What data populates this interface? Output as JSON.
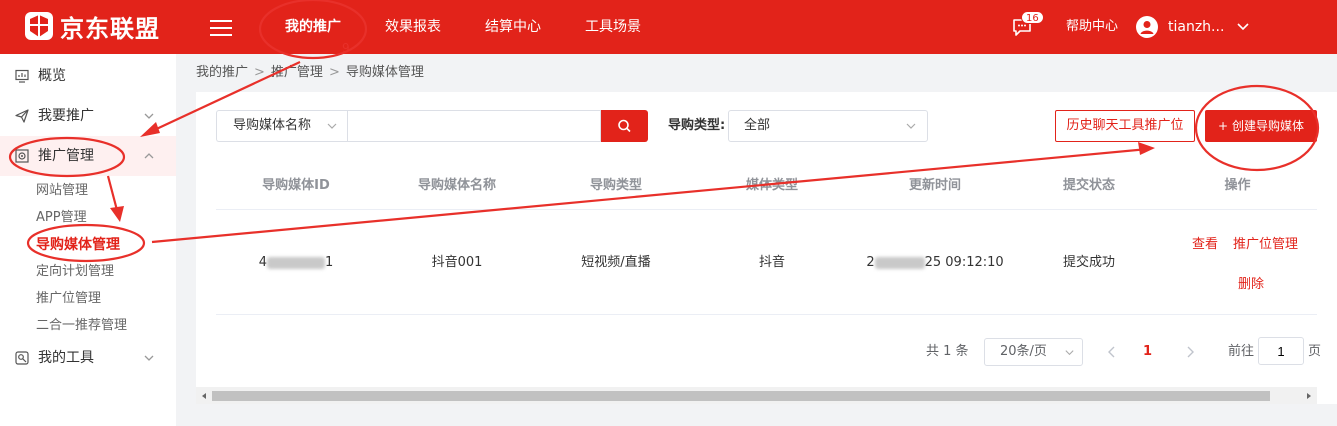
{
  "app": {
    "logo_text": "京东联盟"
  },
  "topnav": [
    {
      "label": "我的推广"
    },
    {
      "label": "效果报表"
    },
    {
      "label": "结算中心"
    },
    {
      "label": "工具场景"
    }
  ],
  "header": {
    "message_count": "16",
    "help": "帮助中心",
    "username": "tianzh..."
  },
  "sidebar": {
    "items": [
      {
        "label": "概览"
      },
      {
        "label": "我要推广"
      },
      {
        "label": "推广管理"
      },
      {
        "label": "我的工具"
      }
    ],
    "sub_items": [
      {
        "label": "网站管理"
      },
      {
        "label": "APP管理"
      },
      {
        "label": "导购媒体管理"
      },
      {
        "label": "定向计划管理"
      },
      {
        "label": "推广位管理"
      },
      {
        "label": "二合一推荐管理"
      }
    ]
  },
  "breadcrumb": [
    "我的推广",
    "推广管理",
    "导购媒体管理"
  ],
  "filter": {
    "field_select": "导购媒体名称",
    "search_value": "",
    "type_label": "导购类型:",
    "type_value": "全部",
    "history_button": "历史聊天工具推广位",
    "create_button": "创建导购媒体",
    "create_icon": "+"
  },
  "table": {
    "columns": [
      "导购媒体ID",
      "导购媒体名称",
      "导购类型",
      "媒体类型",
      "更新时间",
      "提交状态",
      "操作"
    ],
    "rows": [
      {
        "id_visible": "4",
        "id_tail": "1",
        "name": "抖音001",
        "guide_type": "短视频/直播",
        "media_type": "抖音",
        "time_head": "2",
        "time_tail": "25 09:12:10",
        "status": "提交成功",
        "actions": [
          "查看",
          "推广位管理",
          "删除"
        ]
      }
    ]
  },
  "pagination": {
    "total": "共 1 条",
    "page_size": "20条/页",
    "current_page": "1",
    "goto_label": "前往",
    "goto_value": "1",
    "goto_tail": "页"
  },
  "colors": {
    "brand": "#e2231a",
    "annotation": "#e8302a"
  },
  "icons": {
    "nav": "hamburger-icon",
    "message": "message-icon",
    "user": "user-icon",
    "search": "search-icon"
  }
}
